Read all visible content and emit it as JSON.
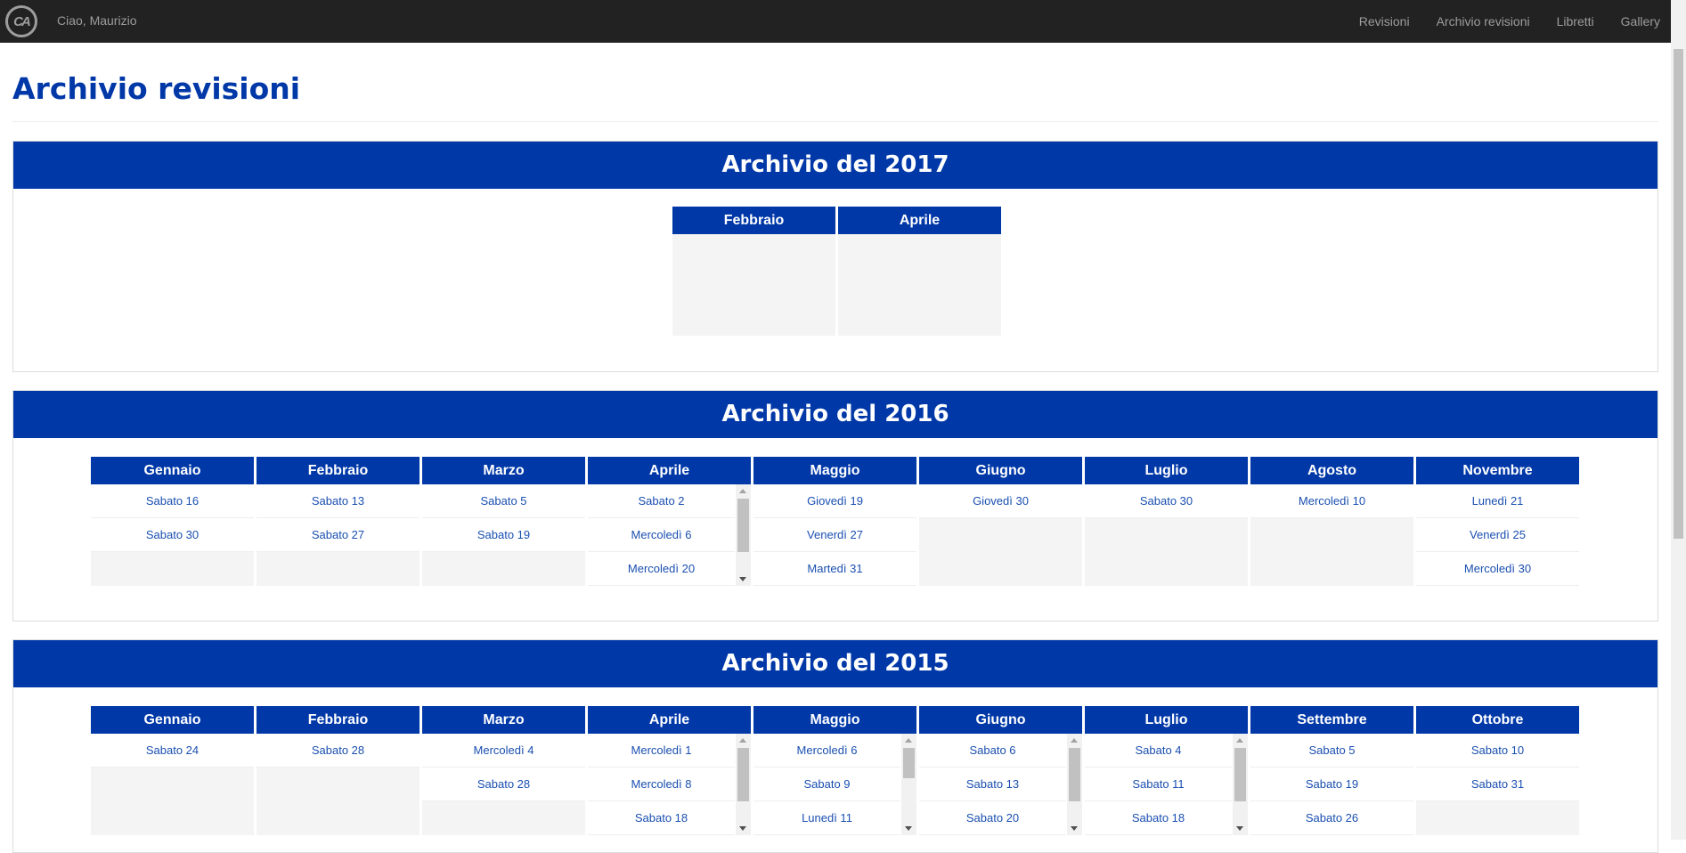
{
  "navbar": {
    "logo_text": "CA",
    "greeting": "Ciao, Maurizio",
    "links": [
      "Revisioni",
      "Archivio revisioni",
      "Libretti",
      "Gallery"
    ]
  },
  "page": {
    "title": "Archivio revisioni"
  },
  "archives": [
    {
      "title": "Archivio del 2017",
      "months": [
        {
          "name": "Febbraio",
          "days": []
        },
        {
          "name": "Aprile",
          "days": []
        }
      ]
    },
    {
      "title": "Archivio del 2016",
      "months": [
        {
          "name": "Gennaio",
          "days": [
            "Sabato 16",
            "Sabato 30"
          ]
        },
        {
          "name": "Febbraio",
          "days": [
            "Sabato 13",
            "Sabato 27"
          ]
        },
        {
          "name": "Marzo",
          "days": [
            "Sabato 5",
            "Sabato 19"
          ]
        },
        {
          "name": "Aprile",
          "days": [
            "Sabato 2",
            "Mercoledì 6",
            "Mercoledì 20"
          ]
        },
        {
          "name": "Maggio",
          "days": [
            "Giovedì 19",
            "Venerdì 27",
            "Martedì 31"
          ]
        },
        {
          "name": "Giugno",
          "days": [
            "Giovedì 30"
          ]
        },
        {
          "name": "Luglio",
          "days": [
            "Sabato 30"
          ]
        },
        {
          "name": "Agosto",
          "days": [
            "Mercoledì 10"
          ]
        },
        {
          "name": "Novembre",
          "days": [
            "Lunedì 21",
            "Venerdì 25",
            "Mercoledì 30"
          ]
        }
      ]
    },
    {
      "title": "Archivio del 2015",
      "months": [
        {
          "name": "Gennaio",
          "days": [
            "Sabato 24"
          ]
        },
        {
          "name": "Febbraio",
          "days": [
            "Sabato 28"
          ]
        },
        {
          "name": "Marzo",
          "days": [
            "Mercoledì 4",
            "Sabato 28"
          ]
        },
        {
          "name": "Aprile",
          "days": [
            "Mercoledì 1",
            "Mercoledì 8",
            "Sabato 18"
          ]
        },
        {
          "name": "Maggio",
          "days": [
            "Mercoledì 6",
            "Sabato 9",
            "Lunedì 11"
          ]
        },
        {
          "name": "Giugno",
          "days": [
            "Sabato 6",
            "Sabato 13",
            "Sabato 20"
          ]
        },
        {
          "name": "Luglio",
          "days": [
            "Sabato 4",
            "Sabato 11",
            "Sabato 18"
          ]
        },
        {
          "name": "Settembre",
          "days": [
            "Sabato 5",
            "Sabato 19",
            "Sabato 26"
          ]
        },
        {
          "name": "Ottobre",
          "days": [
            "Sabato 10",
            "Sabato 31"
          ]
        }
      ]
    }
  ]
}
